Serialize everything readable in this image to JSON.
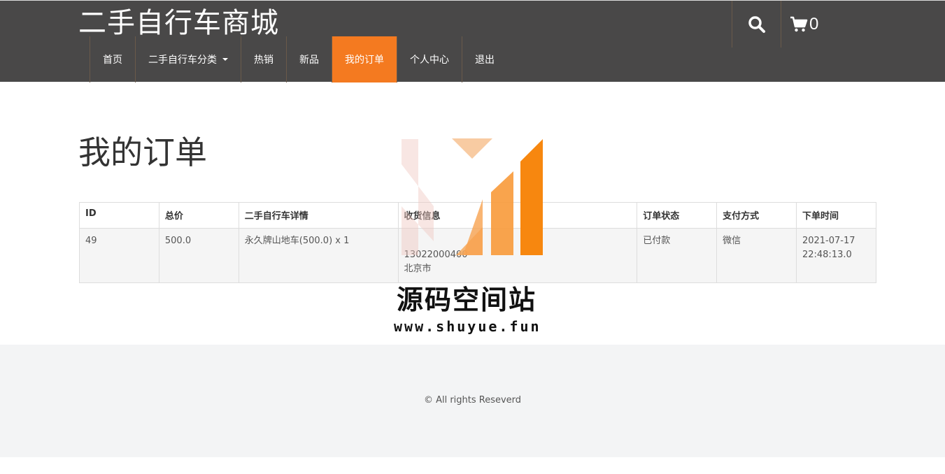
{
  "header": {
    "brand": "二手自行车商城",
    "nav": [
      {
        "label": "首页"
      },
      {
        "label": "二手自行车分类"
      },
      {
        "label": "热销"
      },
      {
        "label": "新品"
      },
      {
        "label": "我的订单"
      },
      {
        "label": "个人中心"
      },
      {
        "label": "退出"
      }
    ],
    "cart_count": "0"
  },
  "main": {
    "title": "我的订单",
    "table": {
      "headers": [
        "ID",
        "总价",
        "二手自行车详情",
        "收货信息",
        "订单状态",
        "支付方式",
        "下单时间"
      ],
      "rows": [
        {
          "id": "49",
          "total": "500.0",
          "detail": "永久牌山地车(500.0) x 1",
          "shipping_line1": "",
          "shipping_line2": "13022000400",
          "shipping_line3": "北京市",
          "status": "已付款",
          "payment": "微信",
          "time_line1": "2021-07-17",
          "time_line2": "22:48:13.0"
        }
      ]
    }
  },
  "watermark": {
    "title": "源码空间站",
    "url": "www.shuyue.fun"
  },
  "footer": {
    "copyright": "© All rights Reseverd"
  },
  "colors": {
    "header_bg": "#494848",
    "accent": "#f47a20",
    "status_paid": "#c0392b",
    "footer_bg": "#f3f4f5"
  },
  "icons": {
    "search": "search-icon",
    "cart": "cart-icon",
    "dropdown": "caret-down-icon"
  }
}
